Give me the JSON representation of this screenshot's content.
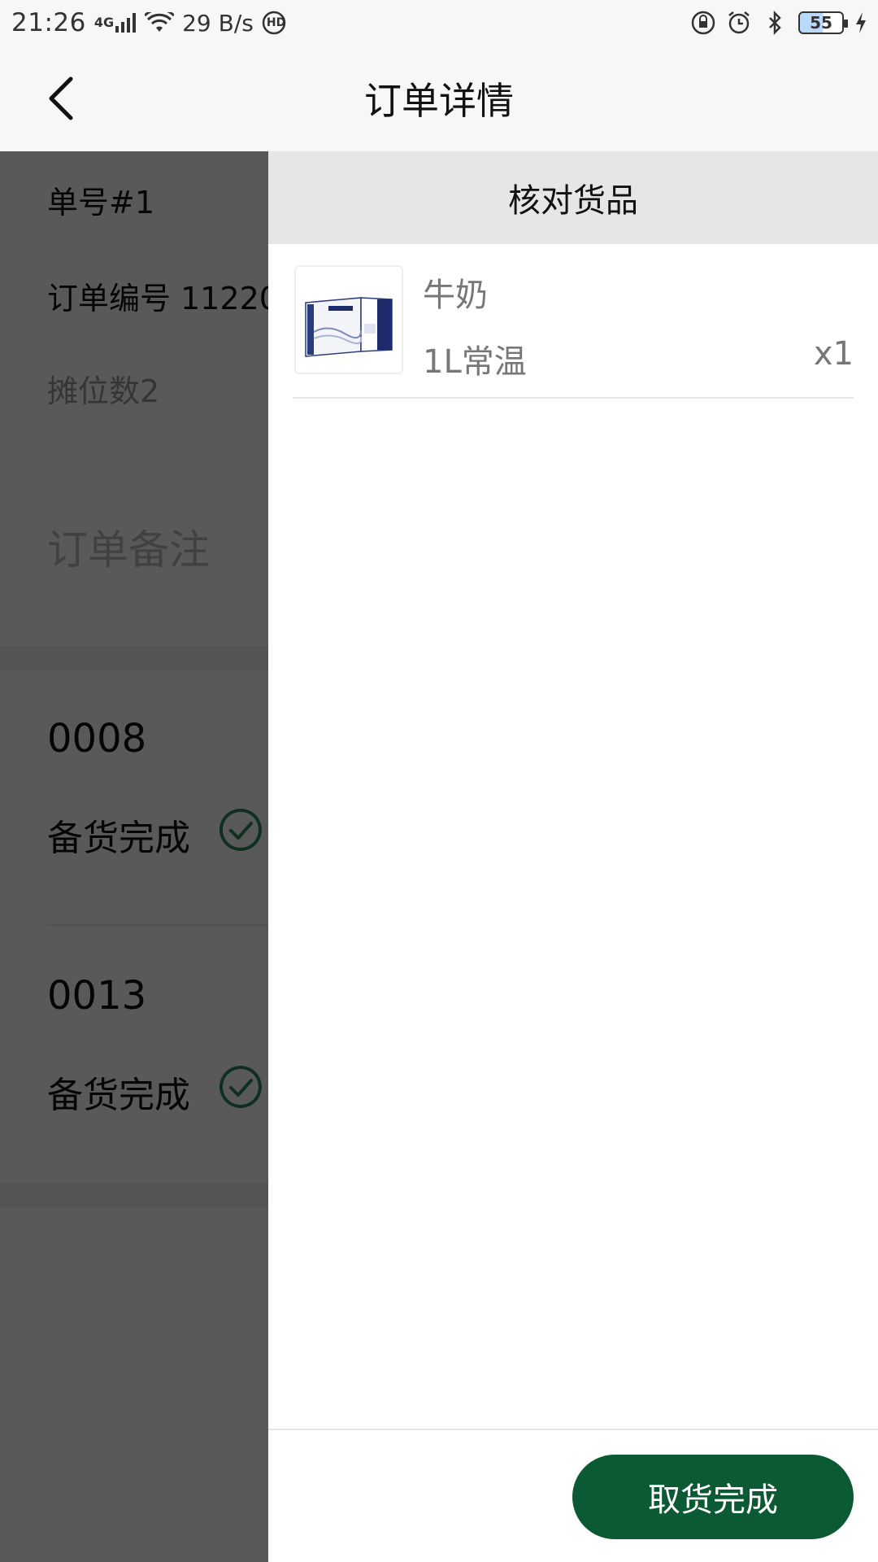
{
  "status_bar": {
    "time": "21:26",
    "network": "4G",
    "speed": "29 B/s",
    "hd": "HD",
    "battery": "55"
  },
  "header": {
    "title": "订单详情"
  },
  "order": {
    "number_label": "单号#1",
    "order_id_label": "订单编号 11220",
    "booth_count": "摊位数2",
    "remark_label": "订单备注",
    "stalls": [
      {
        "code": "0008",
        "status": "备货完成"
      },
      {
        "code": "0013",
        "status": "备货完成"
      }
    ]
  },
  "drawer": {
    "title": "核对货品",
    "items": [
      {
        "name": "牛奶",
        "spec": "1L常温",
        "qty": "x1"
      }
    ],
    "confirm_label": "取货完成"
  },
  "colors": {
    "primary": "#0c5a33",
    "check": "#2c8a5e"
  }
}
